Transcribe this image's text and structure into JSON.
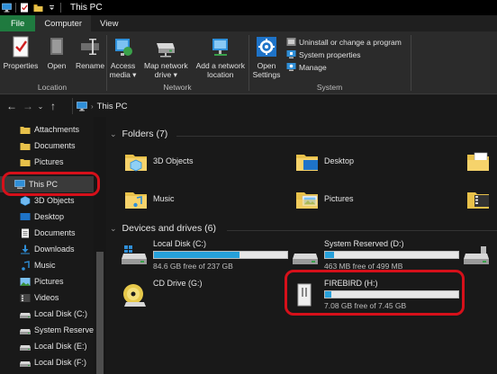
{
  "window": {
    "title": "This PC"
  },
  "ribbon_tabs": [
    {
      "label": "File"
    },
    {
      "label": "Computer"
    },
    {
      "label": "View"
    }
  ],
  "ribbon": {
    "location": {
      "name": "Location",
      "properties": "Properties",
      "open": "Open",
      "rename": "Rename"
    },
    "network": {
      "name": "Network",
      "access_media": [
        "Access",
        "media ▾"
      ],
      "map_network_drive": [
        "Map network",
        "drive ▾"
      ],
      "add_network_location": [
        "Add a network",
        "location"
      ]
    },
    "system": {
      "name": "System",
      "open_settings": [
        "Open",
        "Settings"
      ],
      "uninstall": "Uninstall or change a program",
      "system_properties": "System properties",
      "manage": "Manage"
    }
  },
  "address": {
    "path": "This PC"
  },
  "nav": {
    "items": [
      {
        "label": "Attachments",
        "icon": "folder-icon"
      },
      {
        "label": "Documents",
        "icon": "folder-icon"
      },
      {
        "label": "Pictures",
        "icon": "folder-icon"
      },
      {
        "label": "This PC",
        "icon": "computer-icon"
      },
      {
        "label": "3D Objects",
        "icon": "3d-objects-icon"
      },
      {
        "label": "Desktop",
        "icon": "desktop-icon"
      },
      {
        "label": "Documents",
        "icon": "documents-icon"
      },
      {
        "label": "Downloads",
        "icon": "downloads-icon"
      },
      {
        "label": "Music",
        "icon": "music-icon"
      },
      {
        "label": "Pictures",
        "icon": "pictures-icon"
      },
      {
        "label": "Videos",
        "icon": "videos-icon"
      },
      {
        "label": "Local Disk (C:)",
        "icon": "drive-icon"
      },
      {
        "label": "System Reserved",
        "icon": "drive-icon"
      },
      {
        "label": "Local Disk (E:)",
        "icon": "drive-icon"
      },
      {
        "label": "Local Disk (F:)",
        "icon": "drive-icon"
      }
    ]
  },
  "folders": {
    "header": "Folders (7)",
    "items": [
      {
        "label": "3D Objects"
      },
      {
        "label": "Desktop"
      },
      {
        "label": "Music"
      },
      {
        "label": "Pictures"
      }
    ]
  },
  "drives": {
    "header": "Devices and drives (6)",
    "items": [
      {
        "label": "Local Disk (C:)",
        "free": "84.6 GB free of 237 GB",
        "used_fraction": 0.64
      },
      {
        "label": "System Reserved (D:)",
        "free": "463 MB free of 499 MB",
        "used_fraction": 0.07
      },
      {
        "label": "CD Drive (G:)"
      },
      {
        "label": "FIREBIRD (H:)",
        "free": "7.08 GB free of 7.45 GB",
        "used_fraction": 0.05
      }
    ]
  },
  "colors": {
    "file_tab": "#1f7a3f",
    "progress_fill": "#26a0da",
    "highlight": "#d6101a"
  }
}
